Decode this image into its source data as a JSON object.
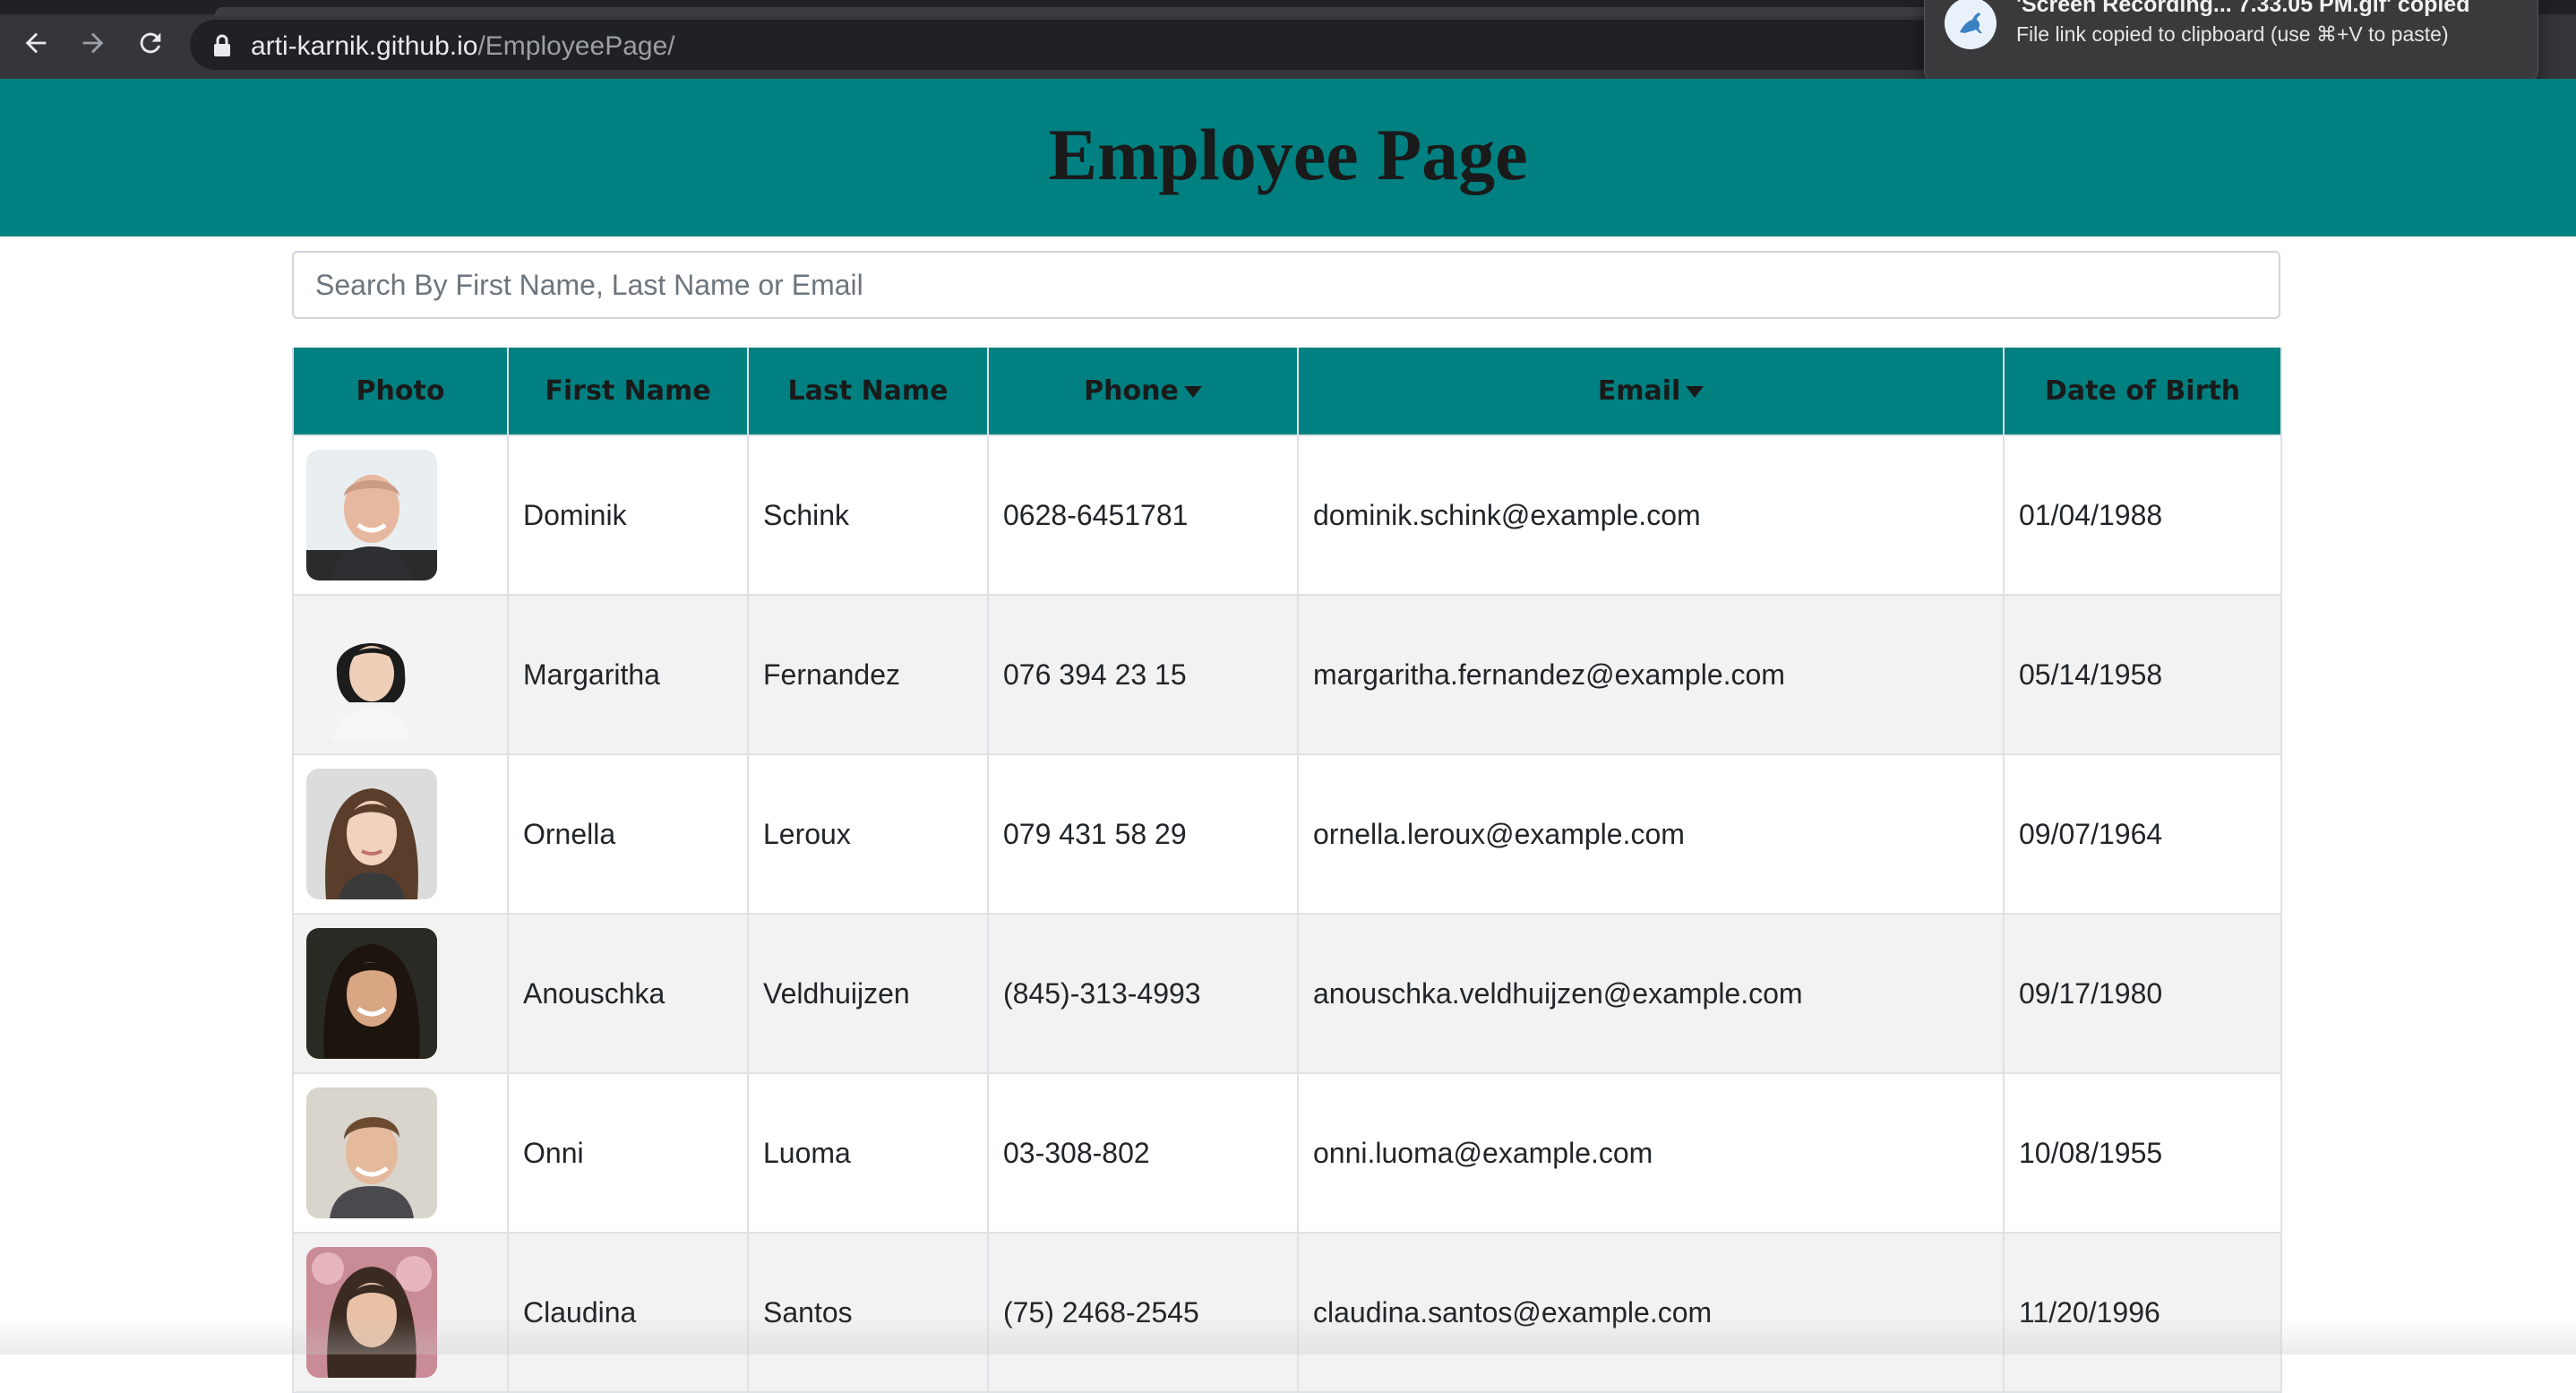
{
  "browser": {
    "url_host": "arti-karnik.github.io",
    "url_path": "/EmployeePage/",
    "back_icon": "arrow-left-icon",
    "forward_icon": "arrow-right-icon",
    "reload_icon": "reload-icon",
    "lock_icon": "lock-icon"
  },
  "notification": {
    "icon": "kangaroo-app-icon",
    "title": "'Screen Recording... 7.33.05 PM.gif' copied",
    "body": "File link copied to clipboard (use ⌘+V to paste)"
  },
  "page": {
    "title": "Employee Page",
    "header_color": "#008080"
  },
  "search": {
    "placeholder": "Search By First Name, Last Name or Email",
    "value": ""
  },
  "table": {
    "columns": [
      "Photo",
      "First Name",
      "Last Name",
      "Phone",
      "Email",
      "Date of Birth"
    ],
    "sortable_icon": "caret-down-icon",
    "rows": [
      {
        "first": "Dominik",
        "last": "Schink",
        "phone": "0628-6451781",
        "email": "dominik.schink@example.com",
        "dob": "01/04/1988"
      },
      {
        "first": "Margaritha",
        "last": "Fernandez",
        "phone": "076 394 23 15",
        "email": "margaritha.fernandez@example.com",
        "dob": "05/14/1958"
      },
      {
        "first": "Ornella",
        "last": "Leroux",
        "phone": "079 431 58 29",
        "email": "ornella.leroux@example.com",
        "dob": "09/07/1964"
      },
      {
        "first": "Anouschka",
        "last": "Veldhuijzen",
        "phone": "(845)-313-4993",
        "email": "anouschka.veldhuijzen@example.com",
        "dob": "09/17/1980"
      },
      {
        "first": "Onni",
        "last": "Luoma",
        "phone": "03-308-802",
        "email": "onni.luoma@example.com",
        "dob": "10/08/1955"
      },
      {
        "first": "Claudina",
        "last": "Santos",
        "phone": "(75) 2468-2545",
        "email": "claudina.santos@example.com",
        "dob": "11/20/1996"
      }
    ]
  }
}
